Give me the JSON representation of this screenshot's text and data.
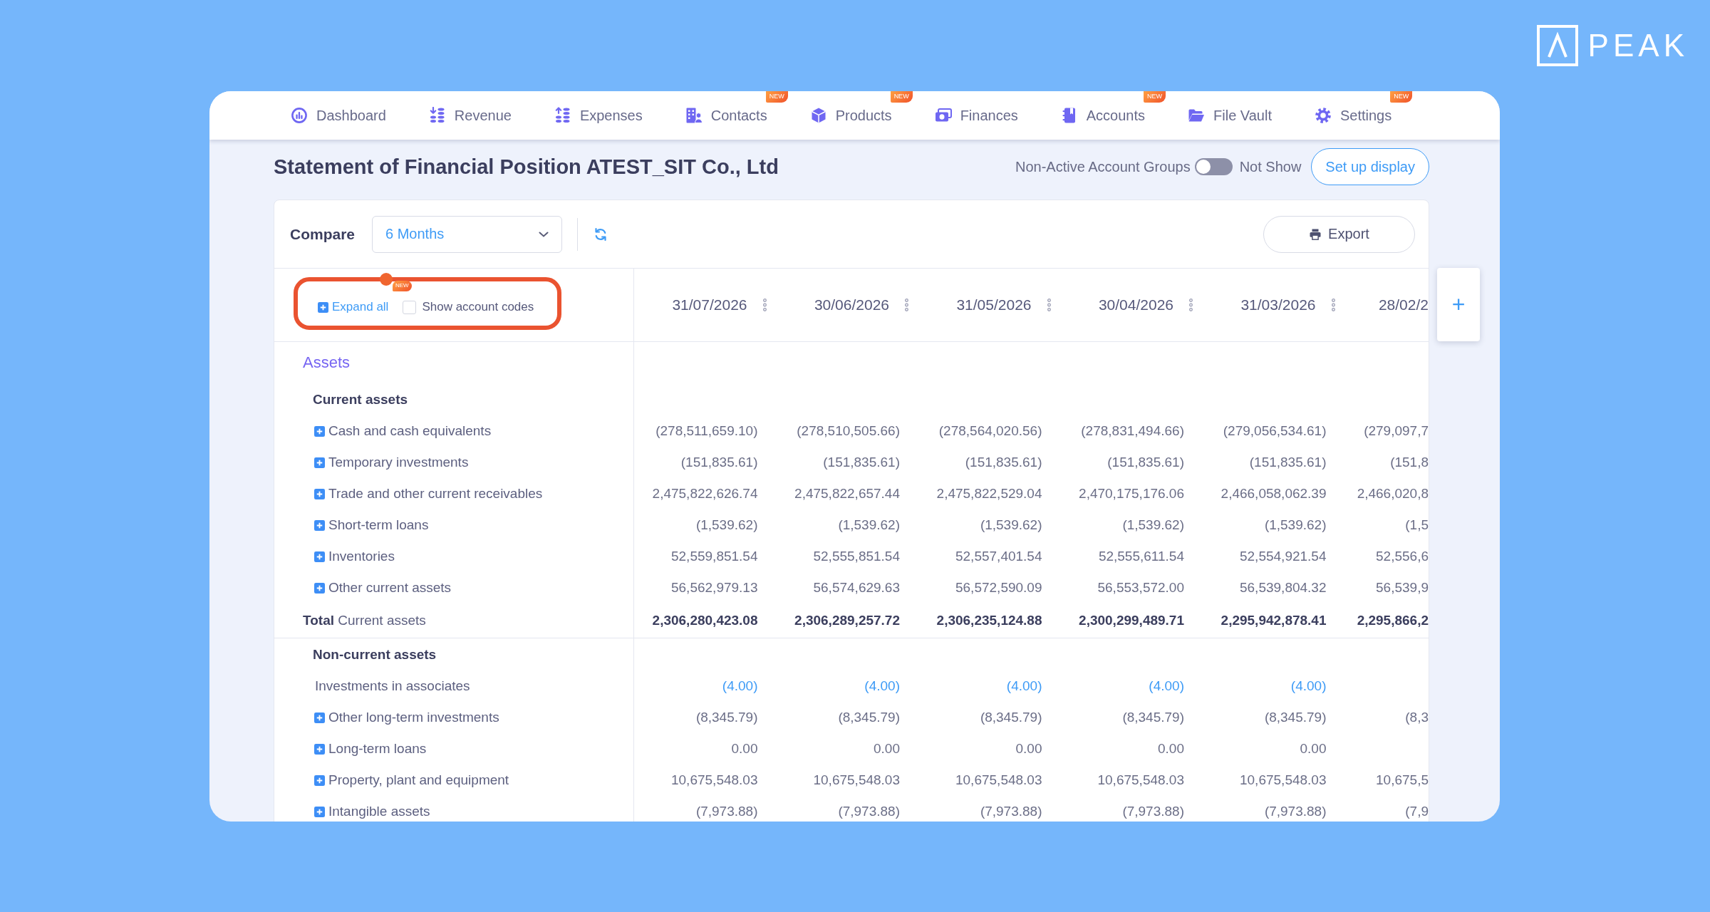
{
  "logo": {
    "text": "PEAK"
  },
  "nav": {
    "items": [
      {
        "label": "Dashboard"
      },
      {
        "label": "Revenue"
      },
      {
        "label": "Expenses"
      },
      {
        "label": "Contacts",
        "badge": "NEW"
      },
      {
        "label": "Products",
        "badge": "NEW"
      },
      {
        "label": "Finances"
      },
      {
        "label": "Accounts",
        "badge": "NEW"
      },
      {
        "label": "File Vault"
      },
      {
        "label": "Settings",
        "badge": "NEW"
      }
    ]
  },
  "header": {
    "title": "Statement of Financial Position ATEST_SIT Co., Ltd",
    "non_active_groups": {
      "label": "Non-Active Account Groups",
      "on": false,
      "state_label": "Not Show"
    },
    "setup_button": "Set up display"
  },
  "toolbar": {
    "compare_label": "Compare",
    "period": "6 Months",
    "export_button": "Export"
  },
  "table": {
    "tools": {
      "highlighted": true,
      "expand_all": "Expand all",
      "badge": "NEW",
      "show_account_codes": {
        "label": "Show account codes",
        "checked": false
      }
    },
    "columns": [
      {
        "label": "31/07/2026",
        "menu": true
      },
      {
        "label": "30/06/2026",
        "menu": true
      },
      {
        "label": "31/05/2026",
        "menu": true
      },
      {
        "label": "30/04/2026",
        "menu": true
      },
      {
        "label": "31/03/2026",
        "menu": true
      },
      {
        "label": "28/02/2",
        "menu": false
      }
    ],
    "add_column_button": "+",
    "sections": [
      {
        "label": "Assets",
        "children": [
          {
            "label": "Current assets",
            "children": [
              {
                "kind": "expandable",
                "label": "Cash and cash equivalents",
                "values": [
                  "(278,511,659.10)",
                  "(278,510,505.66)",
                  "(278,564,020.56)",
                  "(278,831,494.66)",
                  "(279,056,534.61)",
                  "(279,097,7"
                ]
              },
              {
                "kind": "expandable",
                "label": "Temporary investments",
                "values": [
                  "(151,835.61)",
                  "(151,835.61)",
                  "(151,835.61)",
                  "(151,835.61)",
                  "(151,835.61)",
                  "(151,8"
                ]
              },
              {
                "kind": "expandable",
                "label": "Trade and other current receivables",
                "values": [
                  "2,475,822,626.74",
                  "2,475,822,657.44",
                  "2,475,822,529.04",
                  "2,470,175,176.06",
                  "2,466,058,062.39",
                  "2,466,020,8"
                ]
              },
              {
                "kind": "expandable",
                "label": "Short-term loans",
                "values": [
                  "(1,539.62)",
                  "(1,539.62)",
                  "(1,539.62)",
                  "(1,539.62)",
                  "(1,539.62)",
                  "(1,5"
                ]
              },
              {
                "kind": "expandable",
                "label": "Inventories",
                "values": [
                  "52,559,851.54",
                  "52,555,851.54",
                  "52,557,401.54",
                  "52,555,611.54",
                  "52,554,921.54",
                  "52,556,6"
                ]
              },
              {
                "kind": "expandable",
                "label": "Other current assets",
                "values": [
                  "56,562,979.13",
                  "56,574,629.63",
                  "56,572,590.09",
                  "56,553,572.00",
                  "56,539,804.32",
                  "56,539,9"
                ]
              }
            ],
            "total": {
              "label": "**Total** Current assets",
              "values": [
                "2,306,280,423.08",
                "2,306,289,257.72",
                "2,306,235,124.88",
                "2,300,299,489.71",
                "2,295,942,878.41",
                "2,295,866,2"
              ]
            }
          },
          {
            "label": "Non-current assets",
            "children": [
              {
                "kind": "account",
                "label": "Investments in associates",
                "values": [
                  "(4.00)",
                  "(4.00)",
                  "(4.00)",
                  "(4.00)",
                  "(4.00)"
                ]
              },
              {
                "kind": "expandable",
                "label": "Other long-term investments",
                "values": [
                  "(8,345.79)",
                  "(8,345.79)",
                  "(8,345.79)",
                  "(8,345.79)",
                  "(8,345.79)",
                  "(8,3"
                ]
              },
              {
                "kind": "expandable",
                "label": "Long-term loans",
                "values": [
                  "0.00",
                  "0.00",
                  "0.00",
                  "0.00",
                  "0.00"
                ]
              },
              {
                "kind": "expandable",
                "label": "Property, plant and equipment",
                "values": [
                  "10,675,548.03",
                  "10,675,548.03",
                  "10,675,548.03",
                  "10,675,548.03",
                  "10,675,548.03",
                  "10,675,5"
                ]
              },
              {
                "kind": "expandable",
                "label": "Intangible assets",
                "values": [
                  "(7,973.88)",
                  "(7,973.88)",
                  "(7,973.88)",
                  "(7,973.88)",
                  "(7,973.88)",
                  "(7,9"
                ]
              }
            ]
          }
        ]
      }
    ]
  }
}
